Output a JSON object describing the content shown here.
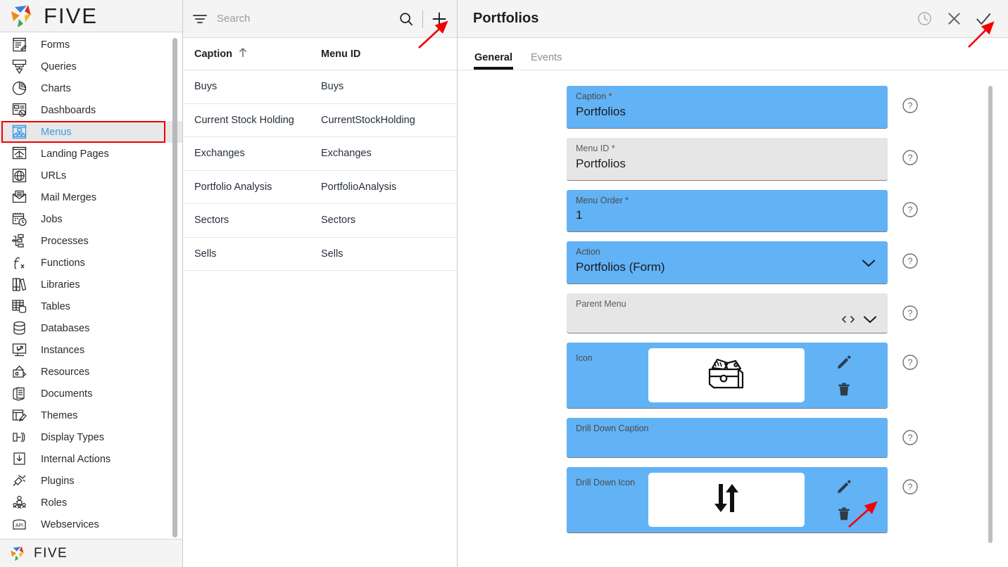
{
  "brand": {
    "name": "FIVE",
    "accent_blue": "#62b2f6",
    "annotation_red": "#f40000"
  },
  "sidebar": {
    "items": [
      {
        "label": "Forms",
        "icon": "forms-icon"
      },
      {
        "label": "Queries",
        "icon": "queries-icon"
      },
      {
        "label": "Charts",
        "icon": "charts-icon"
      },
      {
        "label": "Dashboards",
        "icon": "dashboards-icon"
      },
      {
        "label": "Menus",
        "icon": "menus-icon"
      },
      {
        "label": "Landing Pages",
        "icon": "landing-pages-icon"
      },
      {
        "label": "URLs",
        "icon": "urls-icon"
      },
      {
        "label": "Mail Merges",
        "icon": "mail-merges-icon"
      },
      {
        "label": "Jobs",
        "icon": "jobs-icon"
      },
      {
        "label": "Processes",
        "icon": "processes-icon"
      },
      {
        "label": "Functions",
        "icon": "functions-icon"
      },
      {
        "label": "Libraries",
        "icon": "libraries-icon"
      },
      {
        "label": "Tables",
        "icon": "tables-icon"
      },
      {
        "label": "Databases",
        "icon": "databases-icon"
      },
      {
        "label": "Instances",
        "icon": "instances-icon"
      },
      {
        "label": "Resources",
        "icon": "resources-icon"
      },
      {
        "label": "Documents",
        "icon": "documents-icon"
      },
      {
        "label": "Themes",
        "icon": "themes-icon"
      },
      {
        "label": "Display Types",
        "icon": "display-types-icon"
      },
      {
        "label": "Internal Actions",
        "icon": "internal-actions-icon"
      },
      {
        "label": "Plugins",
        "icon": "plugins-icon"
      },
      {
        "label": "Roles",
        "icon": "roles-icon"
      },
      {
        "label": "Webservices",
        "icon": "webservices-icon"
      }
    ],
    "active_index": 4
  },
  "list": {
    "search": {
      "placeholder": "Search",
      "value": ""
    },
    "filter_icon": "filter-icon",
    "search_icon": "search-icon",
    "add_icon": "plus-icon",
    "columns": [
      {
        "label": "Caption",
        "sort": "ascending",
        "sort_icon": "arrow-up-icon"
      },
      {
        "label": "Menu ID",
        "sort": "none"
      }
    ],
    "rows": [
      {
        "caption": "Buys",
        "menu_id": "Buys"
      },
      {
        "caption": "Current Stock Holding",
        "menu_id": "CurrentStockHolding"
      },
      {
        "caption": "Exchanges",
        "menu_id": "Exchanges"
      },
      {
        "caption": "Portfolio Analysis",
        "menu_id": "PortfolioAnalysis"
      },
      {
        "caption": "Sectors",
        "menu_id": "Sectors"
      },
      {
        "caption": "Sells",
        "menu_id": "Sells"
      }
    ]
  },
  "detail": {
    "title": "Portfolios",
    "header_actions": [
      {
        "name": "history-icon",
        "label": "History"
      },
      {
        "name": "close-icon",
        "label": "Close"
      },
      {
        "name": "checkmark-icon",
        "label": "Save"
      }
    ],
    "tabs": [
      {
        "label": "General",
        "active": true
      },
      {
        "label": "Events",
        "active": false
      }
    ],
    "fields": [
      {
        "name": "caption",
        "label": "Caption *",
        "value": "Portfolios",
        "state": "blue",
        "kind": "text"
      },
      {
        "name": "menu-id",
        "label": "Menu ID *",
        "value": "Portfolios",
        "state": "grey",
        "kind": "text"
      },
      {
        "name": "menu-order",
        "label": "Menu Order *",
        "value": "1",
        "state": "blue",
        "kind": "text"
      },
      {
        "name": "action",
        "label": "Action",
        "value": "Portfolios (Form)",
        "state": "blue",
        "kind": "select"
      },
      {
        "name": "parent-menu",
        "label": "Parent Menu",
        "value": "",
        "state": "grey",
        "kind": "lookup"
      },
      {
        "name": "icon",
        "label": "Icon",
        "value": "",
        "state": "blue",
        "kind": "imagepicker",
        "image": "portfolio-box-icon"
      },
      {
        "name": "drill-down-caption",
        "label": "Drill Down Caption",
        "value": "",
        "state": "blue",
        "kind": "text"
      },
      {
        "name": "drill-down-icon",
        "label": "Drill Down Icon",
        "value": "",
        "state": "blue",
        "kind": "imagepicker",
        "image": "up-down-arrows-icon"
      }
    ],
    "field_action_icons": [
      "edit-pencil-icon",
      "delete-trash-icon"
    ],
    "help_icon": "help-circle-icon"
  },
  "annotations": [
    {
      "name": "arrow-to-add-button",
      "target": "list add (+) button"
    },
    {
      "name": "arrow-to-save-checkmark",
      "target": "save checkmark button"
    },
    {
      "name": "arrow-to-drilldown-edit",
      "target": "drill down icon edit pencil"
    }
  ]
}
